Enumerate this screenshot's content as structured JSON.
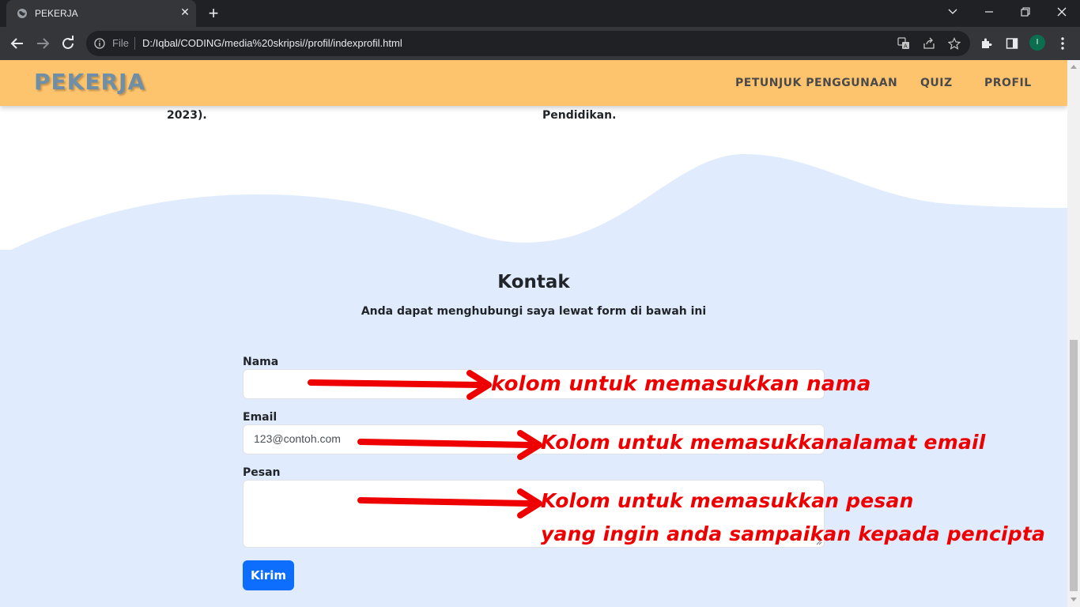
{
  "browser": {
    "tab_title": "PEKERJA",
    "omnibox_scheme": "File",
    "url": "D:/Iqbal/CODING/media%20skripsi//profil/indexprofil.html",
    "profile_initial": "I",
    "icons": [
      "globe-icon",
      "close-icon",
      "plus-icon",
      "chevron-down-icon",
      "minimize-icon",
      "restore-icon",
      "back-arrow-icon",
      "forward-arrow-icon",
      "reload-icon",
      "info-icon",
      "translate-icon",
      "share-icon",
      "star-icon",
      "puzzle-icon",
      "side-panel-icon",
      "kebab-menu-icon"
    ]
  },
  "page": {
    "brand": "PEKERJA",
    "nav": [
      "PETUNJUK PENGGUNAAN",
      "QUIZ",
      "PROFIL"
    ],
    "prev_section": {
      "left_fragment_1": ", ",
      "left_fragment_2": "2023).",
      "right_fragment": "Pendidikan."
    },
    "contact": {
      "title": "Kontak",
      "subtitle": "Anda dapat menghubungi saya lewat form di bawah ini",
      "fields": {
        "name_label": "Nama",
        "name_value": "",
        "email_label": "Email",
        "email_placeholder": "123@contoh.com",
        "message_label": "Pesan",
        "message_value": ""
      },
      "submit_label": "Kirim"
    },
    "annotations": {
      "name": "kolom untuk memasukkan nama",
      "email": "Kolom untuk memasukkanalamat email",
      "message_line1": "Kolom untuk memasukkan pesan",
      "message_line2": "yang ingin anda sampaikan kepada pencipta"
    }
  },
  "colors": {
    "navbar": "#fec46d",
    "brand": "#6f8fa8",
    "section_bg": "#e0ecfd",
    "button": "#0d6efd",
    "annotation": "#ee0000"
  }
}
